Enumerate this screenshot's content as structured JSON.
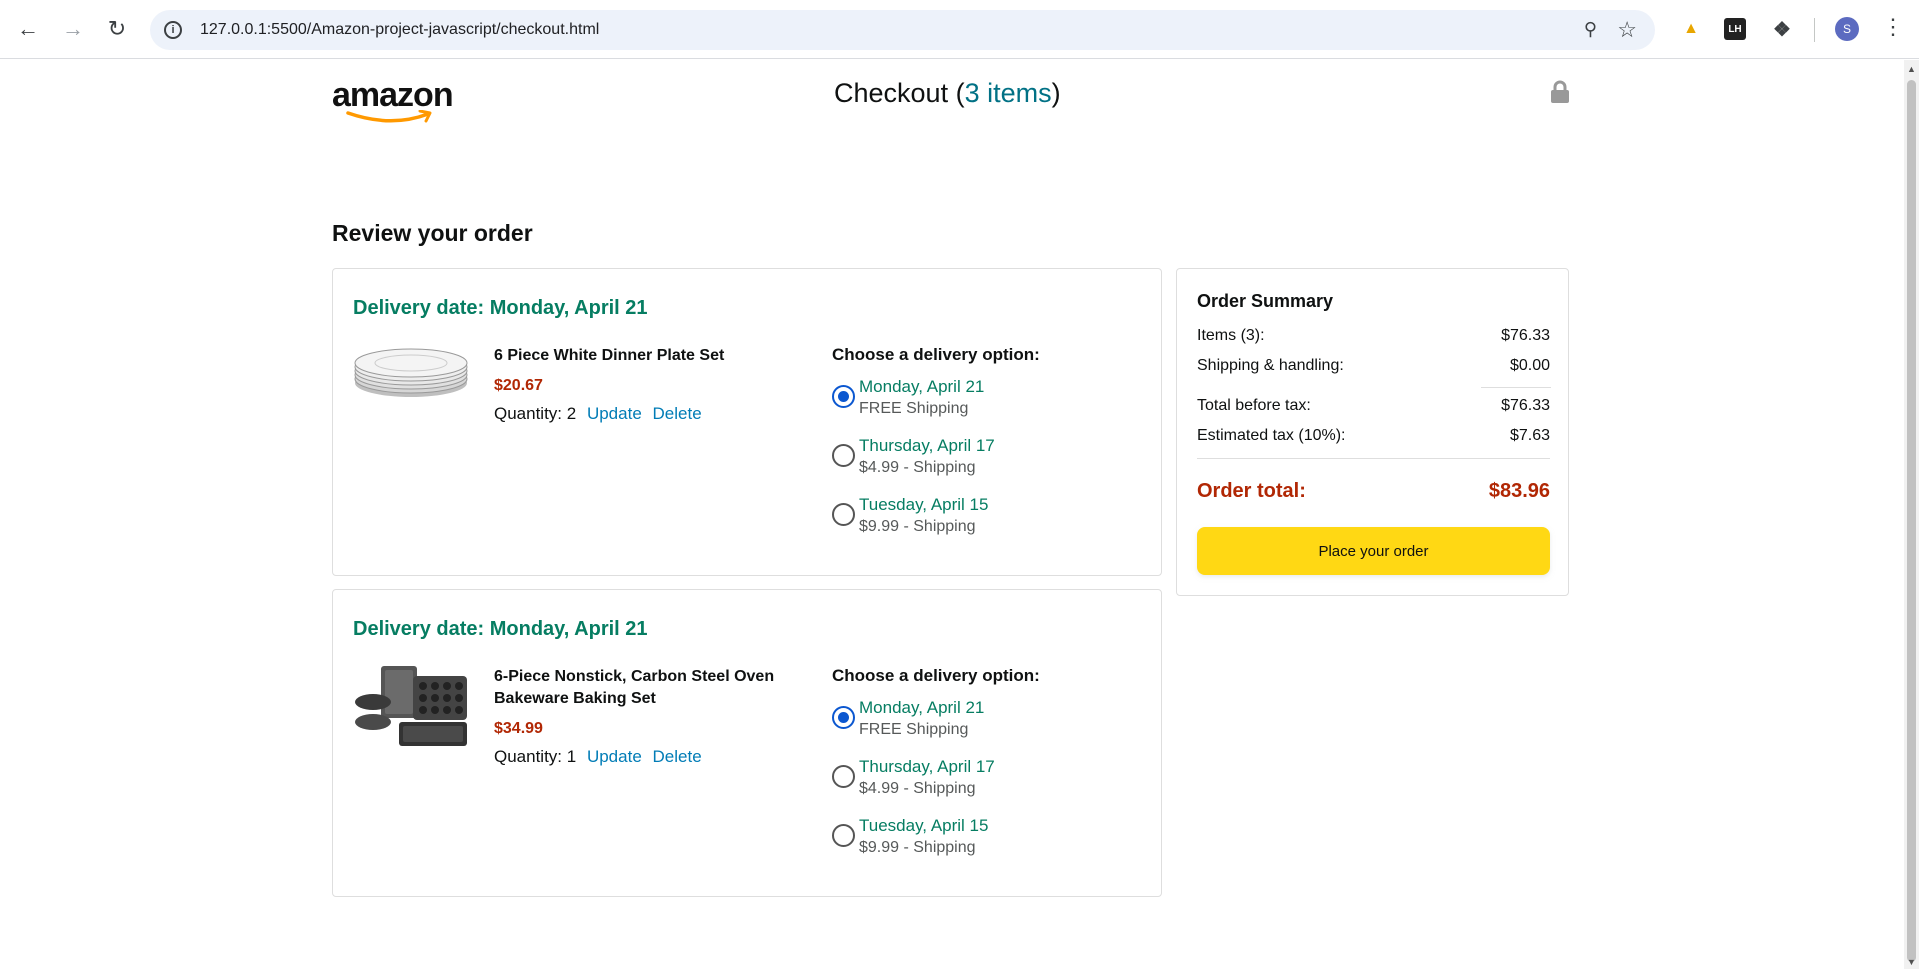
{
  "browser": {
    "url": "127.0.0.1:5500/Amazon-project-javascript/checkout.html",
    "avatar_letter": "S",
    "ext_lh_label": "LH"
  },
  "header": {
    "logo_text": "amazon",
    "checkout_prefix": "Checkout (",
    "items_link": "3 items",
    "checkout_suffix": ")"
  },
  "page_title": "Review your order",
  "cart_items": [
    {
      "delivery_date": "Delivery date: Monday, April 21",
      "name": "6 Piece White Dinner Plate Set",
      "price": "$20.67",
      "quantity_label": "Quantity: 2",
      "update_label": "Update",
      "delete_label": "Delete",
      "delivery_heading": "Choose a delivery option:",
      "options": [
        {
          "date": "Monday, April 21",
          "price": "FREE Shipping",
          "checked": true
        },
        {
          "date": "Thursday, April 17",
          "price": "$4.99 - Shipping",
          "checked": false
        },
        {
          "date": "Tuesday, April 15",
          "price": "$9.99 - Shipping",
          "checked": false
        }
      ]
    },
    {
      "delivery_date": "Delivery date: Monday, April 21",
      "name": "6-Piece Nonstick, Carbon Steel Oven Bakeware Baking Set",
      "price": "$34.99",
      "quantity_label": "Quantity: 1",
      "update_label": "Update",
      "delete_label": "Delete",
      "delivery_heading": "Choose a delivery option:",
      "options": [
        {
          "date": "Monday, April 21",
          "price": "FREE Shipping",
          "checked": true
        },
        {
          "date": "Thursday, April 17",
          "price": "$4.99 - Shipping",
          "checked": false
        },
        {
          "date": "Tuesday, April 15",
          "price": "$9.99 - Shipping",
          "checked": false
        }
      ]
    }
  ],
  "summary": {
    "title": "Order Summary",
    "items_label": "Items (3):",
    "items_value": "$76.33",
    "shipping_label": "Shipping & handling:",
    "shipping_value": "$0.00",
    "before_tax_label": "Total before tax:",
    "before_tax_value": "$76.33",
    "tax_label": "Estimated tax (10%):",
    "tax_value": "$7.63",
    "total_label": "Order total:",
    "total_value": "$83.96",
    "button_label": "Place your order"
  },
  "colors": {
    "green": "#067d62",
    "price_red": "#b12704",
    "link_blue": "#017cb6",
    "button_yellow": "#ffd814"
  }
}
